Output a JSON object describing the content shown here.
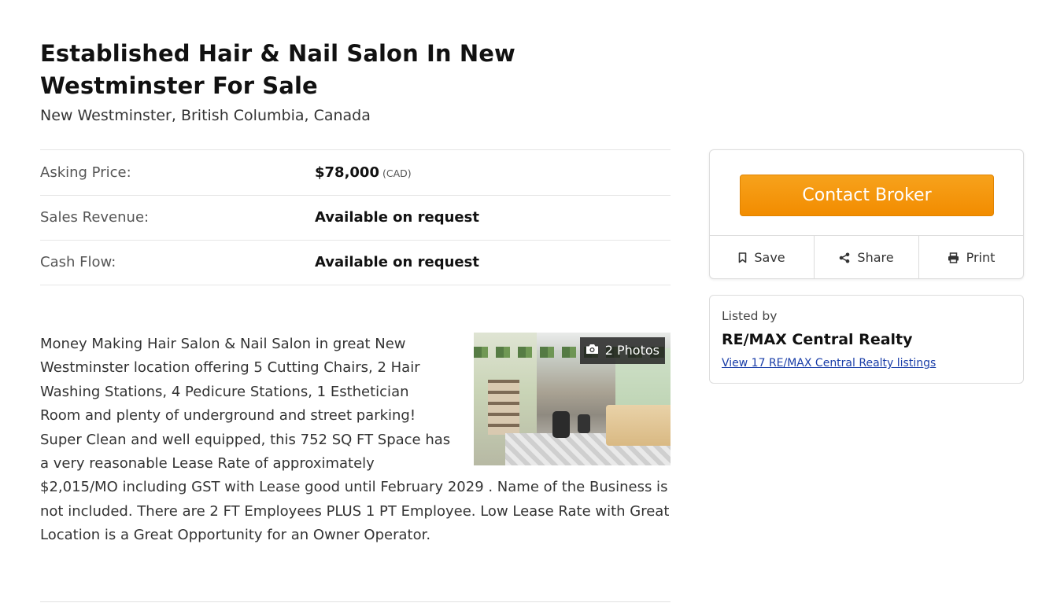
{
  "listing": {
    "title": "Established Hair & Nail Salon In New Westminster For Sale",
    "location": "New Westminster, British Columbia, Canada"
  },
  "financials": [
    {
      "label": "Asking Price:",
      "value": "$78,000",
      "currency": "(CAD)"
    },
    {
      "label": "Sales Revenue:",
      "value": "Available on request",
      "currency": ""
    },
    {
      "label": "Cash Flow:",
      "value": "Available on request",
      "currency": ""
    }
  ],
  "description": "Money Making Hair Salon & Nail Salon in great New Westminster location offering 5 Cutting Chairs, 2 Hair Washing Stations, 4 Pedicure Stations, 1 Esthetician Room and plenty of underground and street parking! Super Clean and well equipped, this 752 SQ FT Space has a very reasonable Lease Rate of approximately $2,015/MO including GST with Lease good until February 2029 . Name of the Business is not included. There are 2 FT Employees PLUS 1 PT Employee. Low Lease Rate with Great Location is a Great Opportunity for an Owner Operator.",
  "photos": {
    "badge_label": "2 Photos",
    "icon": "camera-icon"
  },
  "contact": {
    "button_label": "Contact Broker",
    "button_color": "#f28c00",
    "actions": [
      {
        "label": "Save",
        "icon": "bookmark-icon"
      },
      {
        "label": "Share",
        "icon": "share-icon"
      },
      {
        "label": "Print",
        "icon": "print-icon"
      }
    ]
  },
  "broker": {
    "listed_by_label": "Listed by",
    "name": "RE/MAX Central Realty",
    "listings_link": "View 17 RE/MAX Central Realty listings",
    "link_color": "#1a3ea8"
  }
}
